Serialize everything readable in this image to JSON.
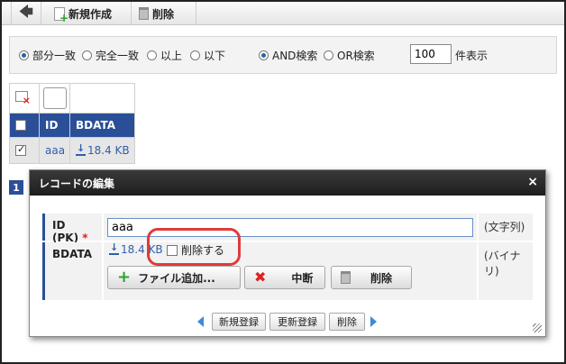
{
  "toolbar": {
    "back_icon": "left-arrow-icon",
    "new_label": "新規作成",
    "delete_label": "削除"
  },
  "search": {
    "match_options": [
      {
        "label": "部分一致",
        "selected": true
      },
      {
        "label": "完全一致",
        "selected": false
      },
      {
        "label": "以上",
        "selected": false
      },
      {
        "label": "以下",
        "selected": false
      }
    ],
    "logic_options": [
      {
        "label": "AND検索",
        "selected": true
      },
      {
        "label": "OR検索",
        "selected": false
      }
    ],
    "count_value": "100",
    "count_unit": "件表示"
  },
  "grid": {
    "columns": [
      "ID",
      "BDATA"
    ],
    "rows": [
      {
        "checked": true,
        "id": "aaa",
        "bdata": "18.4 KB"
      }
    ],
    "page": "1"
  },
  "dialog": {
    "title": "レコードの編集",
    "close": "×",
    "fields": [
      {
        "label": "ID (PK)",
        "required_mark": "*",
        "value": "aaa",
        "type": "(文字列)"
      },
      {
        "label": "BDATA",
        "file_size": "18.4 KB",
        "delete_checkbox_label": "削除する",
        "type": "(バイナリ)"
      }
    ],
    "buttons": {
      "add_file": "ファイル追加...",
      "abort": "中断",
      "remove": "削除"
    },
    "actions": {
      "create": "新規登録",
      "update": "更新登録",
      "delete": "削除"
    }
  },
  "colors": {
    "header_blue": "#2a4f97",
    "link_blue": "#2f5fa8",
    "highlight_red": "#e03a3a"
  }
}
